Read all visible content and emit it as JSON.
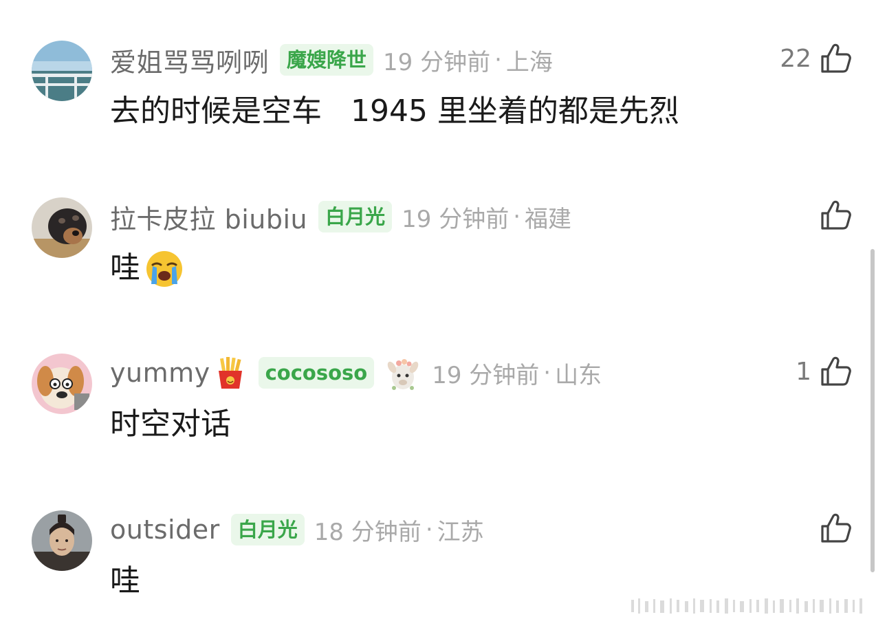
{
  "comments": [
    {
      "username": "爱姐骂骂咧咧",
      "badge": "魔嫂降世",
      "time": "19 分钟前",
      "separator": "·",
      "location": "上海",
      "text": "去的时候是空车   1945 里坐着的都是先烈",
      "likes": "22",
      "avatar_icon": "seaside-railing-avatar"
    },
    {
      "username": "拉卡皮拉 biubiu",
      "badge": "白月光",
      "time": "19 分钟前",
      "separator": "·",
      "location": "福建",
      "text": "哇",
      "text_emoji": "crying-face-emoji",
      "likes": "",
      "avatar_icon": "masked-dog-avatar"
    },
    {
      "username": "yummy",
      "username_emoji": "french-fries-emoji",
      "badge": "cocososo",
      "badge_decoration": "alpaca-sticker",
      "time": "19 分钟前",
      "separator": "·",
      "location": "山东",
      "text": "时空对话",
      "likes": "1",
      "avatar_icon": "cartoon-dog-avatar"
    },
    {
      "username": "outsider",
      "badge": "白月光",
      "time": "18 分钟前",
      "separator": "·",
      "location": "江苏",
      "text": "哇",
      "likes": "",
      "avatar_icon": "man-portrait-avatar"
    }
  ],
  "colors": {
    "badge_bg": "#eaf7ea",
    "badge_text": "#3aa64a",
    "username": "#6b6b6b",
    "meta": "#a9a9a9",
    "body_text": "#1a1a1a"
  },
  "icons": {
    "like": "thumbs-up-icon"
  }
}
